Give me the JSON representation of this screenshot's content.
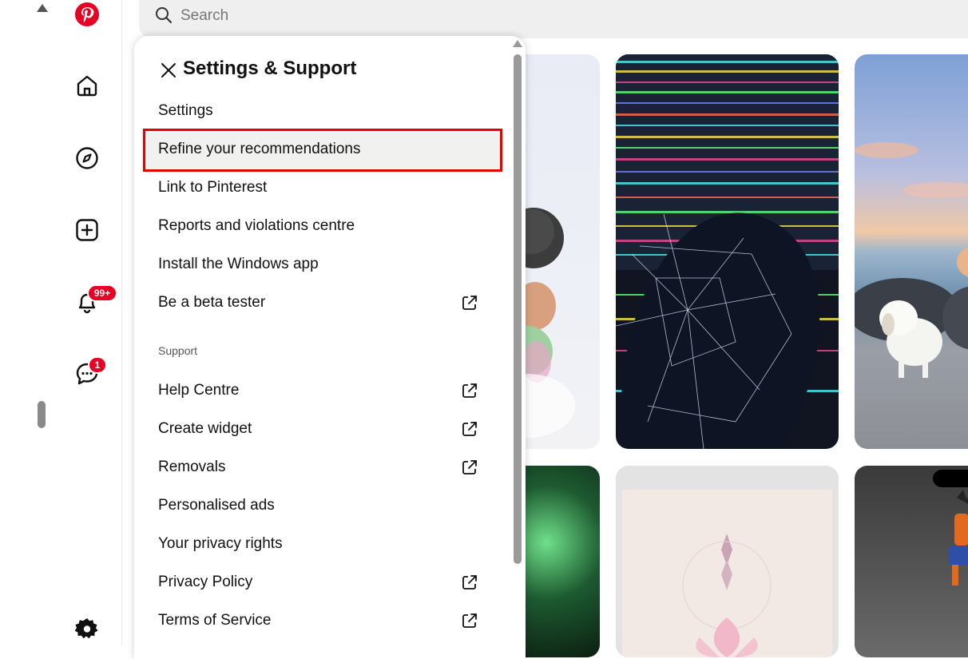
{
  "search": {
    "placeholder": "Search"
  },
  "nav": {
    "notifications_badge": "99+",
    "messages_badge": "1"
  },
  "panel": {
    "title": "Settings & Support",
    "items": [
      {
        "label": "Settings",
        "external": false
      },
      {
        "label": "Refine your recommendations",
        "external": false,
        "highlighted": true
      },
      {
        "label": "Link to Pinterest",
        "external": false
      },
      {
        "label": "Reports and violations centre",
        "external": false
      },
      {
        "label": "Install the Windows app",
        "external": false
      },
      {
        "label": "Be a beta tester",
        "external": true
      }
    ],
    "support_label": "Support",
    "support_items": [
      {
        "label": "Help Centre",
        "external": true
      },
      {
        "label": "Create widget",
        "external": true
      },
      {
        "label": "Removals",
        "external": true
      },
      {
        "label": "Personalised ads",
        "external": false
      },
      {
        "label": "Your privacy rights",
        "external": false
      },
      {
        "label": "Privacy Policy",
        "external": true
      },
      {
        "label": "Terms of Service",
        "external": true
      }
    ]
  },
  "colors": {
    "brand": "#e60023",
    "highlight_border": "#e60000"
  }
}
